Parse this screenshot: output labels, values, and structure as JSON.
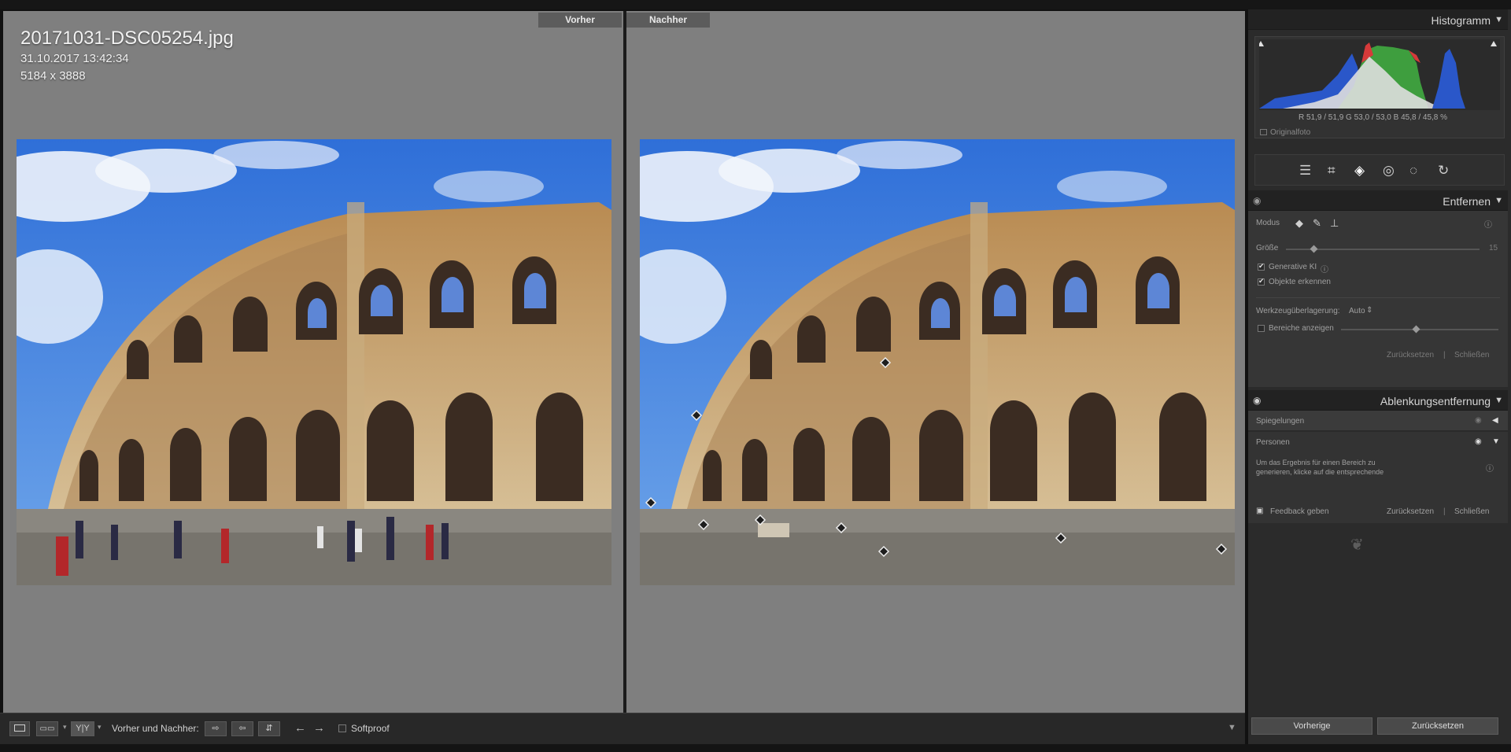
{
  "viewer": {
    "before_label": "Vorher",
    "after_label": "Nachher",
    "filename": "20171031-DSC05254.jpg",
    "datetime": "31.10.2017 13:42:34",
    "dimensions": "5184 x 3888"
  },
  "toolbar": {
    "view_loupe": "",
    "view_compare_label": "",
    "view_yy_label": "Y|Y",
    "before_after_label": "Vorher und Nachher:",
    "softproof_label": "Softproof"
  },
  "histogram": {
    "title": "Histogramm",
    "rgb_readout": "R  51,9 / 51,9  G  53,0 / 53,0  B  45,8 / 45,8  %",
    "original_photo_label": "Originalfoto"
  },
  "remove_panel": {
    "title": "Entfernen",
    "mode_label": "Modus",
    "size_label": "Größe",
    "size_value": "15",
    "generative_ai_label": "Generative KI",
    "detect_objects_label": "Objekte erkennen",
    "overlay_label": "Werkzeugüberlagerung:",
    "overlay_value": "Auto",
    "show_areas_label": "Bereiche anzeigen",
    "reset_label": "Zurücksetzen",
    "close_label": "Schließen"
  },
  "distraction_panel": {
    "title": "Ablenkungsentfernung",
    "reflections_label": "Spiegelungen",
    "people_label": "Personen",
    "hint_line1": "Um das Ergebnis für einen Bereich zu",
    "hint_line2": "generieren, klicke auf die entsprechende",
    "feedback_label": "Feedback geben",
    "reset_label": "Zurücksetzen",
    "close_label": "Schließen"
  },
  "bottom_buttons": {
    "previous_label": "Vorherige",
    "reset_label": "Zurücksetzen"
  }
}
